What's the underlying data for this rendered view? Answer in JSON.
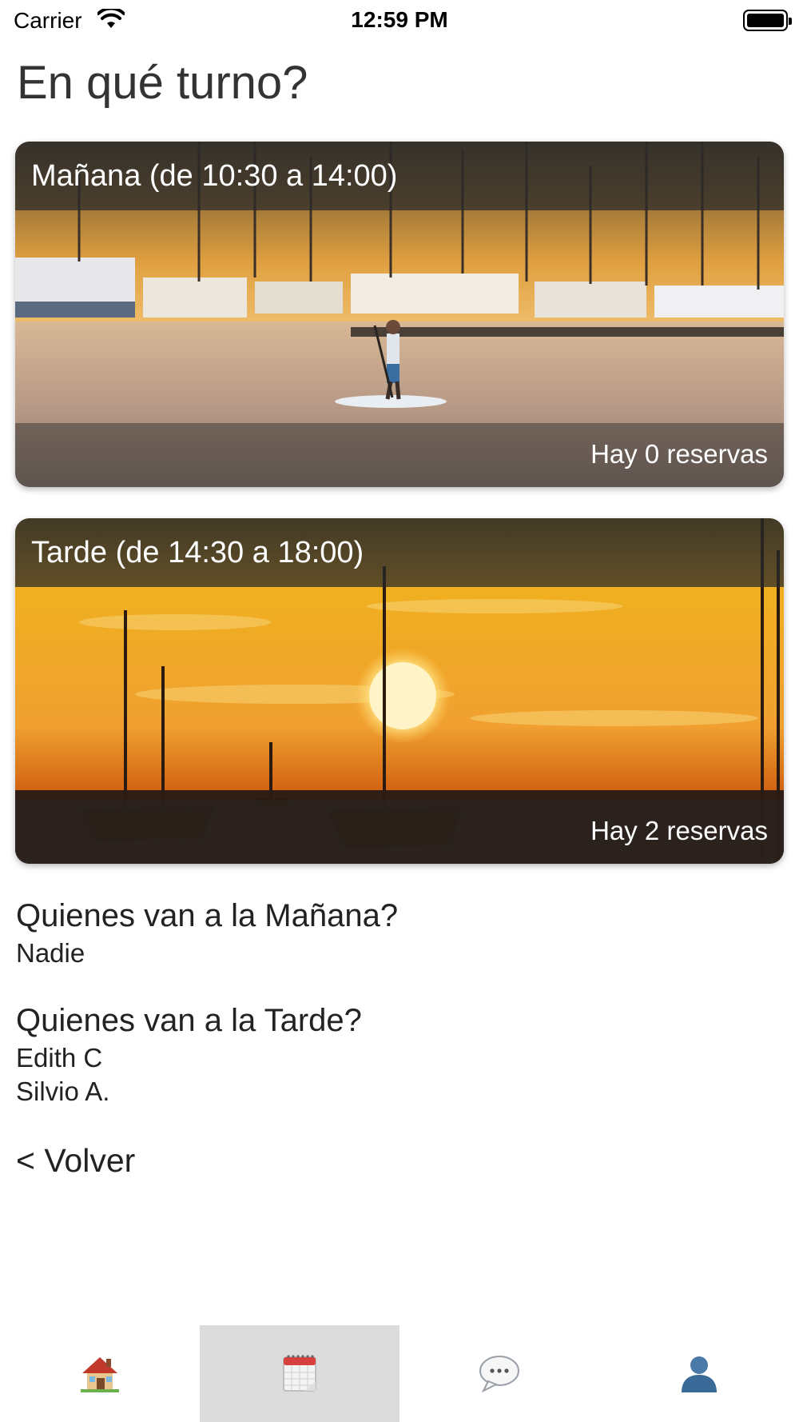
{
  "status_bar": {
    "carrier": "Carrier",
    "time": "12:59 PM"
  },
  "page": {
    "title": "En qué turno?"
  },
  "shifts": [
    {
      "title": "Mañana (de 10:30 a 14:00)",
      "count_text": "Hay 0 reservas"
    },
    {
      "title": "Tarde (de 14:30 a 18:00)",
      "count_text": "Hay 2 reservas"
    }
  ],
  "attendees": {
    "morning": {
      "heading": "Quienes van a la Mañana?",
      "names": [
        "Nadie"
      ]
    },
    "afternoon": {
      "heading": "Quienes van a la Tarde?",
      "names": [
        "Edith C",
        "Silvio A."
      ]
    }
  },
  "back_label": "< Volver",
  "tab_bar": {
    "active_tab": "calendar",
    "tabs": [
      {
        "icon": "house-icon"
      },
      {
        "icon": "calendar-icon"
      },
      {
        "icon": "speech-bubble-icon"
      },
      {
        "icon": "user-silhouette-icon"
      }
    ]
  },
  "colors": {
    "overlay": "#282828",
    "active_tab_bg": "#dcdcdc",
    "text": "#222222"
  }
}
